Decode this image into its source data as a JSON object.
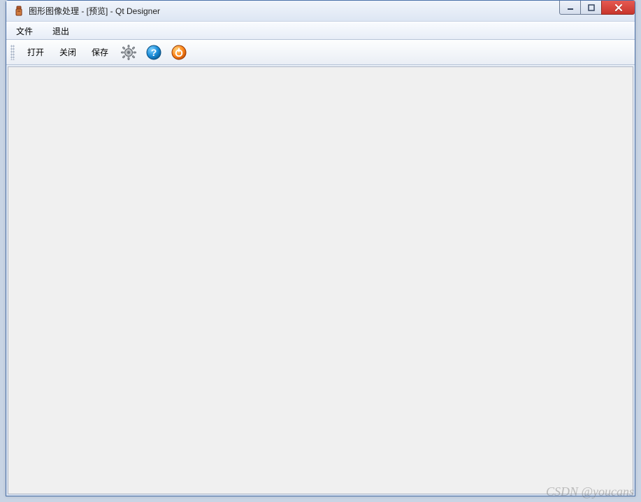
{
  "titlebar": {
    "title": "图形图像处理 - [预览] - Qt Designer"
  },
  "menubar": {
    "file": "文件",
    "exit": "退出"
  },
  "toolbar": {
    "open": "打开",
    "close": "关闭",
    "save": "保存"
  },
  "icons": {
    "app": "app-icon",
    "gear": "gear-icon",
    "help": "help-icon",
    "power": "power-icon",
    "minimize": "minimize-icon",
    "maximize": "maximize-icon",
    "close_win": "close-icon"
  },
  "watermark": "CSDN @youcans"
}
